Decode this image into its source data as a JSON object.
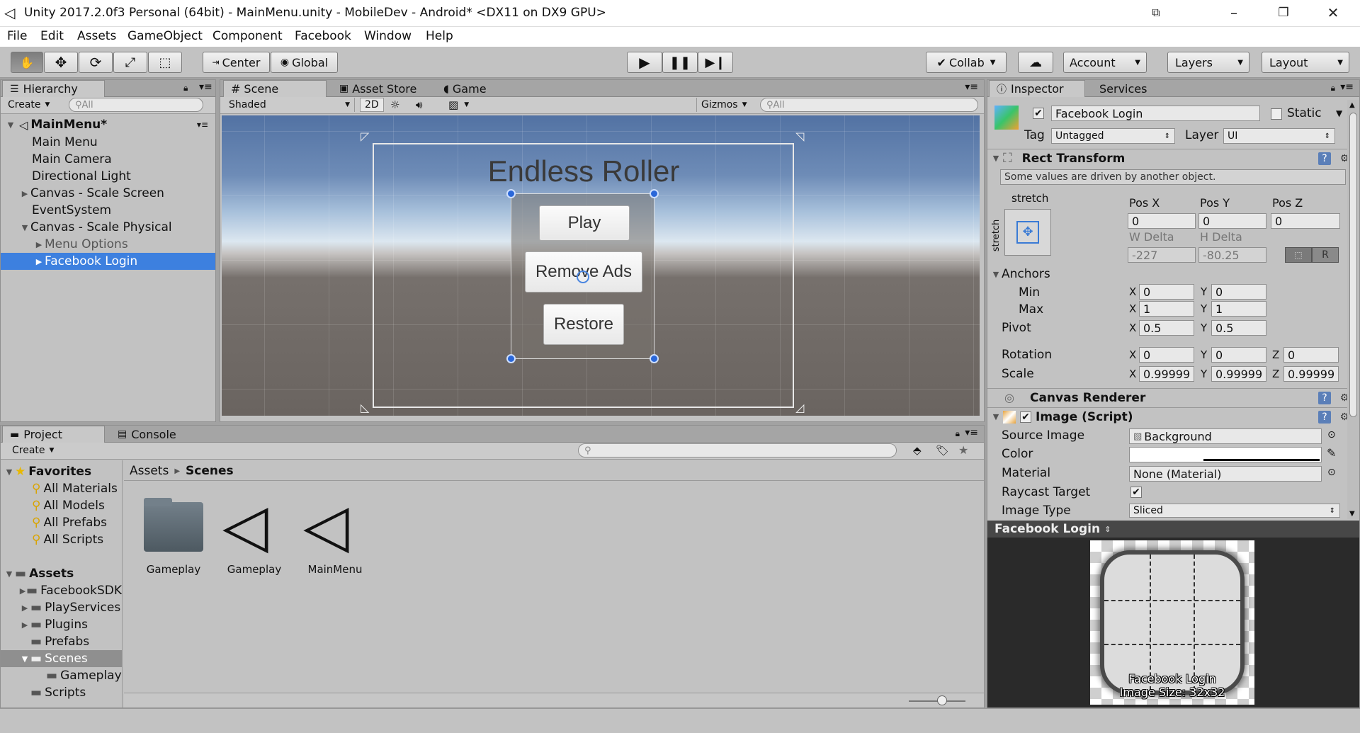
{
  "window": {
    "title": "Unity 2017.2.0f3 Personal (64bit) - MainMenu.unity - MobileDev - Android* <DX11 on DX9 GPU>"
  },
  "menu": [
    "File",
    "Edit",
    "Assets",
    "GameObject",
    "Component",
    "Facebook",
    "Window",
    "Help"
  ],
  "toolbar": {
    "center": "Center",
    "global": "Global",
    "collab": "Collab",
    "account": "Account",
    "layers": "Layers",
    "layout": "Layout"
  },
  "hierarchy": {
    "tab": "Hierarchy",
    "create": "Create",
    "search_placeholder": "All",
    "scene": "MainMenu*",
    "items": [
      "Main Menu",
      "Main Camera",
      "Directional Light",
      "Canvas - Scale Screen",
      "EventSystem",
      "Canvas - Scale Physical",
      "Menu Options",
      "Facebook Login"
    ]
  },
  "scene": {
    "tabs": [
      "Scene",
      "Asset Store",
      "Game"
    ],
    "shaded": "Shaded",
    "mode2d": "2D",
    "gizmos": "Gizmos",
    "search_placeholder": "All",
    "title": "Endless Roller",
    "buttons": [
      "Play",
      "Remove Ads",
      "Restore"
    ]
  },
  "project": {
    "tabs": [
      "Project",
      "Console"
    ],
    "create": "Create",
    "favorites_label": "Favorites",
    "favorites": [
      "All Materials",
      "All Models",
      "All Prefabs",
      "All Scripts"
    ],
    "assets_label": "Assets",
    "assets": [
      "FacebookSDK",
      "PlayServices",
      "Plugins",
      "Prefabs",
      "Scenes",
      "Gameplay",
      "Scripts"
    ],
    "breadcrumb": [
      "Assets",
      "Scenes"
    ],
    "files": [
      "Gameplay",
      "Gameplay",
      "MainMenu"
    ]
  },
  "inspector": {
    "tabs": [
      "Inspector",
      "Services"
    ],
    "name": "Facebook Login",
    "static": "Static",
    "tag_label": "Tag",
    "tag": "Untagged",
    "layer_label": "Layer",
    "layer": "UI",
    "rect": {
      "title": "Rect Transform",
      "note": "Some values are driven by another object.",
      "stretch": "stretch",
      "posx_l": "Pos X",
      "posy_l": "Pos Y",
      "posz_l": "Pos Z",
      "posx": "0",
      "posy": "0",
      "posz": "0",
      "wd_l": "W Delta",
      "hd_l": "H Delta",
      "wd": "-227",
      "hd": "-80.25",
      "r": "R",
      "anchors": "Anchors",
      "min": "Min",
      "max": "Max",
      "pivot": "Pivot",
      "rotation": "Rotation",
      "scale": "Scale",
      "min_x": "0",
      "min_y": "0",
      "max_x": "1",
      "max_y": "1",
      "piv_x": "0.5",
      "piv_y": "0.5",
      "rot_x": "0",
      "rot_y": "0",
      "rot_z": "0",
      "sc_x": "0.99999",
      "sc_y": "0.99999",
      "sc_z": "0.99999",
      "X": "X",
      "Y": "Y",
      "Z": "Z"
    },
    "canvas_renderer": "Canvas Renderer",
    "image": {
      "title": "Image (Script)",
      "source_l": "Source Image",
      "source": "Background",
      "color_l": "Color",
      "material_l": "Material",
      "material": "None (Material)",
      "raycast_l": "Raycast Target",
      "type_l": "Image Type",
      "type": "Sliced"
    },
    "preview": {
      "title": "Facebook Login",
      "caption1": "Facebook Login",
      "caption2": "Image Size: 32x32"
    }
  }
}
